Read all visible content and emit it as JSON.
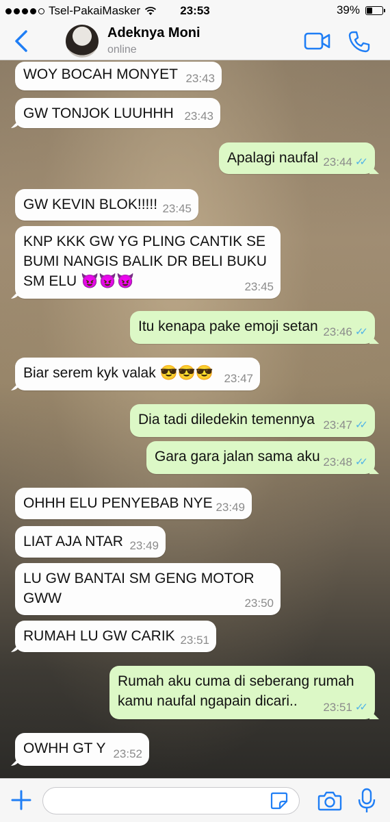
{
  "status_bar": {
    "carrier": "Tsel-PakaiMasker",
    "time": "23:53",
    "battery": "39%",
    "battery_level": 0.39,
    "signal_bars": 4
  },
  "header": {
    "contact_name": "Adeknya Moni",
    "status": "online",
    "icons": [
      "chevron-left-icon",
      "video-call-icon",
      "phone-call-icon"
    ],
    "accent_color": "#1f7ef5"
  },
  "messages": [
    {
      "direction": "in",
      "text": "WOY BOCAH MONYET",
      "time": "23:43"
    },
    {
      "direction": "in",
      "text": "GW TONJOK LUUHHH",
      "time": "23:43"
    },
    {
      "direction": "out",
      "text": "Apalagi naufal",
      "time": "23:44"
    },
    {
      "direction": "in",
      "text": "GW KEVIN BLOK!!!!!",
      "time": "23:45"
    },
    {
      "direction": "in",
      "text": "KNP KKK GW YG PLING CANTIK SE\nBUMI NANGIS BALIK DR BELI BUKU\nSM ELU 😈😈😈",
      "time": "23:45"
    },
    {
      "direction": "out",
      "text": "Itu kenapa pake emoji setan",
      "time": "23:46"
    },
    {
      "direction": "in",
      "text": "Biar serem kyk valak 😎😎😎",
      "time": "23:47"
    },
    {
      "direction": "out",
      "text": "Dia tadi diledekin temennya",
      "time": "23:47"
    },
    {
      "direction": "out",
      "text": "Gara gara jalan sama aku",
      "time": "23:48"
    },
    {
      "direction": "in",
      "text": "OHHH ELU PENYEBAB NYE",
      "time": "23:49"
    },
    {
      "direction": "in",
      "text": "LIAT AJA NTAR",
      "time": "23:49"
    },
    {
      "direction": "in",
      "text": "LU GW BANTAI SM GENG MOTOR\nGWW",
      "time": "23:50"
    },
    {
      "direction": "in",
      "text": "RUMAH LU GW CARIK",
      "time": "23:51"
    },
    {
      "direction": "out",
      "text": "Rumah aku cuma di seberang rumah\nkamu naufal ngapain dicari..",
      "time": "23:51"
    },
    {
      "direction": "in",
      "text": "OWHH GT Y",
      "time": "23:52"
    }
  ],
  "read_ticks": "✓✓",
  "input_bar": {
    "placeholder": "",
    "icons": [
      "plus-icon",
      "sticker-icon",
      "camera-icon",
      "microphone-icon"
    ]
  }
}
